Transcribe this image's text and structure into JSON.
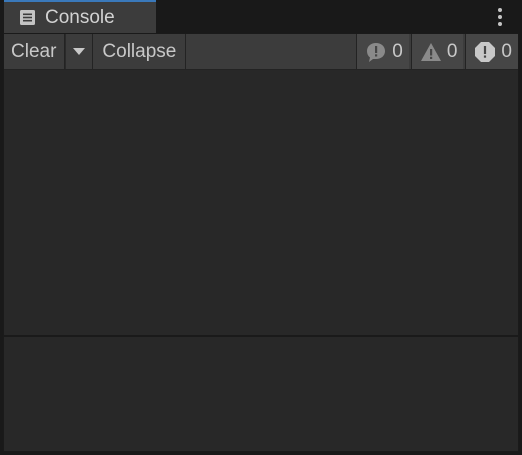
{
  "window": {
    "tab_label": "Console",
    "tab_icon": "console-list-icon",
    "accent": "#3a79bb",
    "menu_icon": "kebab-menu-icon"
  },
  "toolbar": {
    "clear_label": "Clear",
    "clear_dropdown_icon": "triangle-down-icon",
    "collapse_label": "Collapse",
    "counts": {
      "info": "0",
      "warning": "0",
      "error": "0"
    },
    "icons": {
      "info": "info-bubble-icon",
      "warning": "warning-triangle-icon",
      "error": "error-octagon-icon"
    }
  }
}
